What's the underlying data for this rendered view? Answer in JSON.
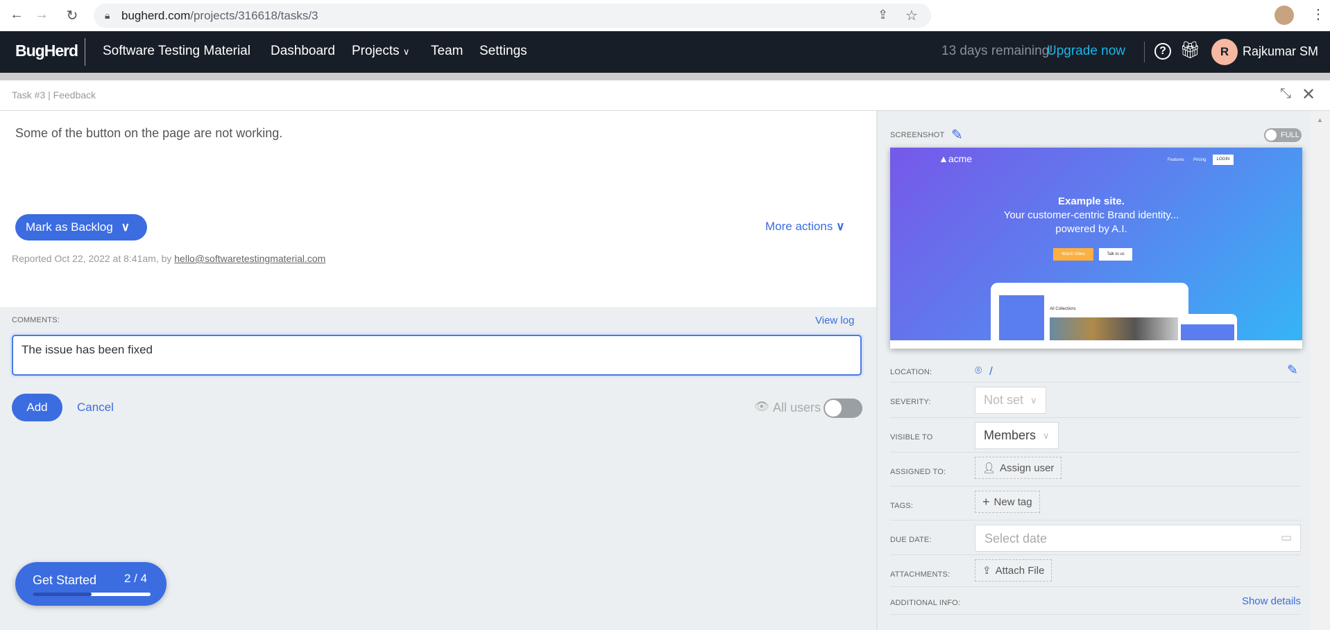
{
  "browser": {
    "url_host": "bugherd.com",
    "url_path": "/projects/316618/tasks/3"
  },
  "nav": {
    "logo": "BugHerd",
    "org": "Software Testing Material",
    "items": [
      "Dashboard",
      "Projects",
      "Team",
      "Settings"
    ],
    "trial": "13 days remaining!",
    "upgrade": "Upgrade now",
    "avatar_initial": "R",
    "user": "Rajkumar SM"
  },
  "task": {
    "header": "Task #3 | Feedback",
    "description": "Some of the button on the page are not working.",
    "status_button": "Mark as Backlog",
    "more_actions": "More actions",
    "reported_prefix": "Reported Oct 22, 2022 at 8:41am, by ",
    "reporter": "hello@softwaretestingmaterial.com"
  },
  "comments": {
    "label": "COMMENTS:",
    "view_log": "View log",
    "value": "The issue has been fixed",
    "add": "Add",
    "cancel": "Cancel",
    "visibility": "All users"
  },
  "onboarding": {
    "label": "Get Started",
    "progress_text": "2 / 4",
    "progress": 0.5
  },
  "side": {
    "screenshot_label": "SCREENSHOT",
    "full_toggle": "FULL",
    "preview": {
      "logo": "acme",
      "links": [
        "Features",
        "Pricing"
      ],
      "login": "LOGIN",
      "title": "Example site.",
      "line1": "Your customer-centric Brand identity...",
      "line2": "powered by A.I.",
      "btn1": "Watch Video",
      "btn2": "Talk to us",
      "collections": "All Collections"
    },
    "location_label": "LOCATION:",
    "location": "/",
    "severity_label": "SEVERITY:",
    "severity": "Not set",
    "visible_label": "VISIBLE TO",
    "visible": "Members",
    "assigned_label": "ASSIGNED TO:",
    "assign": "Assign user",
    "tags_label": "TAGS:",
    "new_tag": "New tag",
    "due_label": "DUE DATE:",
    "due_placeholder": "Select date",
    "attach_label": "ATTACHMENTS:",
    "attach": "Attach File",
    "additional_label": "ADDITIONAL INFO:",
    "show_details": "Show details"
  },
  "colors": {
    "accent": "#3b6ce0",
    "nav_bg": "#171e27",
    "upgrade": "#1ab4e8",
    "avatar": "#f6b8a2"
  }
}
